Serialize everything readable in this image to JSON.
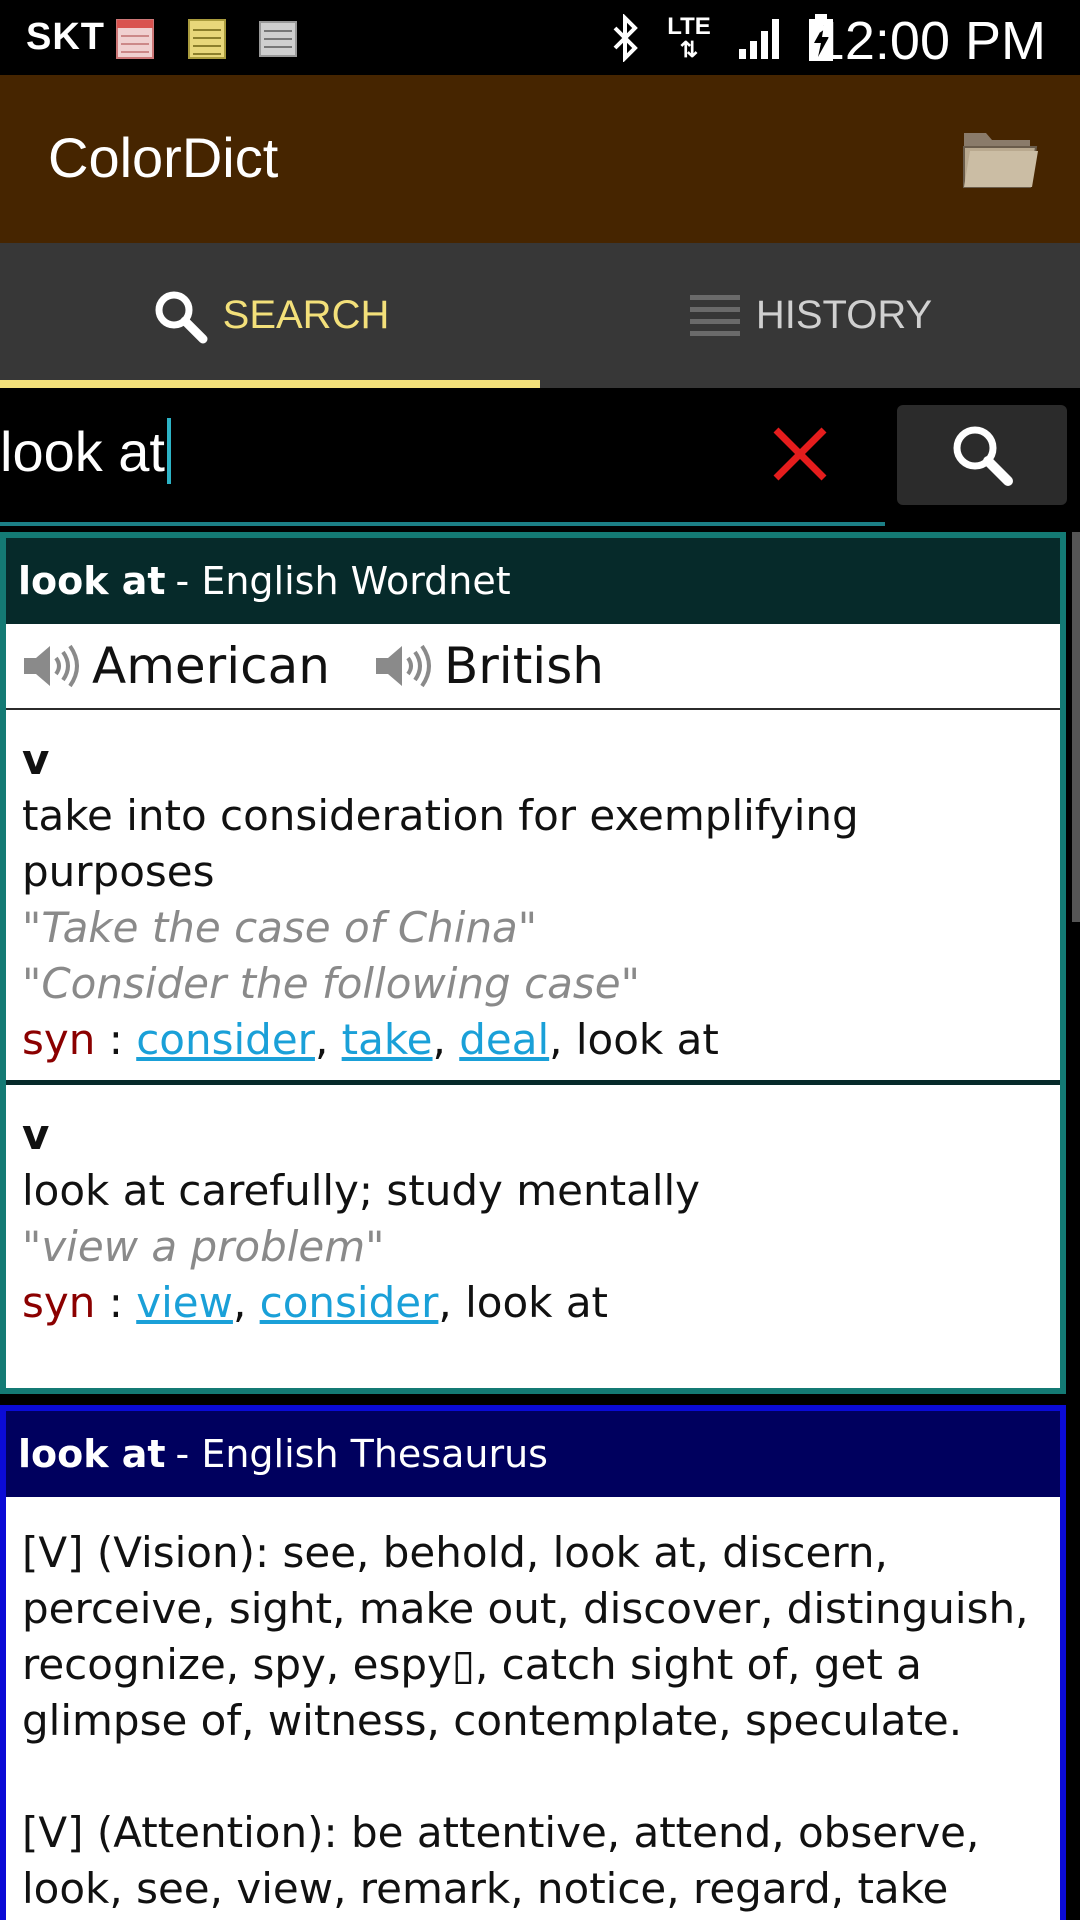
{
  "status_bar": {
    "carrier": "SKT",
    "network": "LTE",
    "time": "12:00 PM",
    "icons": [
      "calendar-notification-icon",
      "note-notification-icon",
      "list-notification-icon",
      "bluetooth-icon",
      "lte-data-icon",
      "signal-icon",
      "battery-charging-icon"
    ]
  },
  "action_bar": {
    "title": "ColorDict",
    "folder_icon": "folder-icon",
    "background": "#462500"
  },
  "tabs": [
    {
      "label": "SEARCH",
      "icon": "search-icon",
      "selected": true
    },
    {
      "label": "HISTORY",
      "icon": "list-icon",
      "selected": false
    }
  ],
  "accent_color": "#f3e07a",
  "search": {
    "value": "look at",
    "clear_icon": "close-icon",
    "search_icon": "search-icon"
  },
  "wordnet": {
    "headword": "look at",
    "source": "- English Wordnet",
    "header_color": "#062a2a",
    "border_color": "#147a74",
    "pronunciations": [
      {
        "label": "American",
        "icon": "speaker-icon"
      },
      {
        "label": "British",
        "icon": "speaker-icon"
      }
    ],
    "senses": [
      {
        "pos": "v",
        "definition": "take into consideration for exemplifying purposes",
        "examples": [
          "\"Take the case of China\"",
          "\"Consider the following case\""
        ],
        "syn_label": "syn",
        "syn_links": [
          "consider",
          "take",
          "deal"
        ],
        "syn_plain": "look at"
      },
      {
        "pos": "v",
        "definition": "look at carefully; study mentally",
        "examples": [
          "\"view a problem\""
        ],
        "syn_label": "syn",
        "syn_links": [
          "view",
          "consider"
        ],
        "syn_plain": "look at"
      }
    ]
  },
  "thesaurus": {
    "headword": "look at",
    "source": "- English Thesaurus",
    "header_color": "#00005e",
    "border_color": "#0b0bd6",
    "paragraphs": [
      "[V] (Vision):  see, behold, look at, discern, perceive, sight, make out, discover, distinguish, recognize, spy, espy▯, catch sight of, get a glimpse of, witness, contemplate, speculate.",
      "[V] (Attention):  be attentive, attend, observe, look, see, view, remark, notice, regard, take"
    ]
  }
}
